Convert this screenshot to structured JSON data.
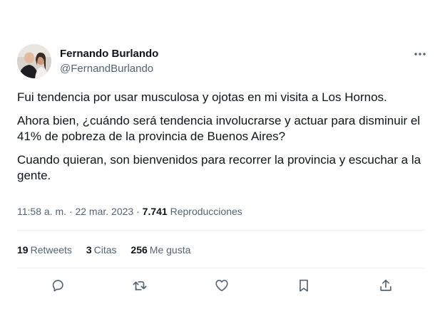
{
  "author": {
    "name": "Fernando Burlando",
    "handle": "@FernandBurlando"
  },
  "tweet": {
    "paragraphs": [
      "Fui tendencia por usar musculosa y ojotas en mi visita a Los Hornos.",
      "Ahora bien, ¿cuándo será tendencia involucrarse y actuar para disminuir el 41% de pobreza de la provincia de Buenos Aires?",
      "Cuando quieran, son bienvenidos para recorrer la provincia y escuchar a la gente."
    ],
    "time": "11:58 a. m.",
    "separator": "·",
    "date": "22 mar. 2023",
    "views_count": "7.741",
    "views_label": "Reproducciones"
  },
  "stats": {
    "retweets_count": "19",
    "retweets_label": "Retweets",
    "quotes_count": "3",
    "quotes_label": "Citas",
    "likes_count": "256",
    "likes_label": "Me gusta"
  },
  "icons": {
    "more": "more-horizontal-icon",
    "reply": "reply-icon",
    "retweet": "retweet-icon",
    "like": "heart-icon",
    "bookmark": "bookmark-icon",
    "share": "share-icon"
  },
  "colors": {
    "text": "#0f1419",
    "secondary": "#536471",
    "divider": "#eff3f4"
  }
}
